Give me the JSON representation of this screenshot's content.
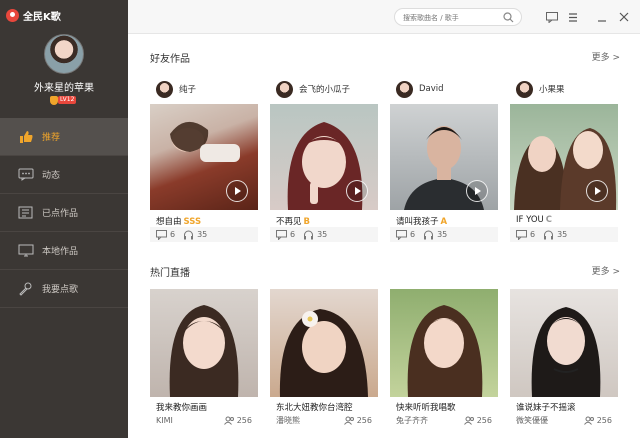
{
  "app": {
    "name": "全民K歌",
    "brand_color": "#e8473c",
    "accent": "#f0a52b"
  },
  "profile": {
    "username": "外来星的苹果",
    "level": "LV12"
  },
  "sidebar": {
    "items": [
      {
        "label": "推荐",
        "icon": "thumbs-up-icon",
        "active": true
      },
      {
        "label": "动态",
        "icon": "chat-icon",
        "active": false
      },
      {
        "label": "已点作品",
        "icon": "list-icon",
        "active": false
      },
      {
        "label": "本地作品",
        "icon": "monitor-icon",
        "active": false
      },
      {
        "label": "我要点歌",
        "icon": "microphone-icon",
        "active": false
      }
    ]
  },
  "topbar": {
    "search_placeholder": "搜索歌曲名 / 歌手",
    "buttons": [
      "message-icon",
      "menu-icon",
      "minimize-icon",
      "close-icon"
    ]
  },
  "friends": {
    "title": "好友作品",
    "more": "更多 >",
    "cards": [
      {
        "user": "纯子",
        "song": "想自由",
        "grade": "SSS",
        "grade_color": "#f0a52b",
        "comments": "6",
        "listens": "35"
      },
      {
        "user": "会飞的小瓜子",
        "song": "不再见",
        "grade": "B",
        "grade_color": "#f0a52b",
        "comments": "6",
        "listens": "35"
      },
      {
        "user": "David",
        "song": "请叫我孩子",
        "grade": "A",
        "grade_color": "#f0a52b",
        "comments": "6",
        "listens": "35"
      },
      {
        "user": "小果果",
        "song": "IF YOU",
        "grade": "C",
        "grade_color": "#999999",
        "comments": "6",
        "listens": "35"
      }
    ]
  },
  "live": {
    "title": "热门直播",
    "more": "更多 >",
    "cards": [
      {
        "title": "我来教你画画",
        "host": "KIMI",
        "viewers": "256"
      },
      {
        "title": "东北大妞教你台湾腔",
        "host": "潘晓熊",
        "viewers": "256"
      },
      {
        "title": "快来听听我唱歌",
        "host": "兔子齐齐",
        "viewers": "256"
      },
      {
        "title": "谁说妹子不摇滚",
        "host": "微笑優優",
        "viewers": "256"
      }
    ]
  }
}
